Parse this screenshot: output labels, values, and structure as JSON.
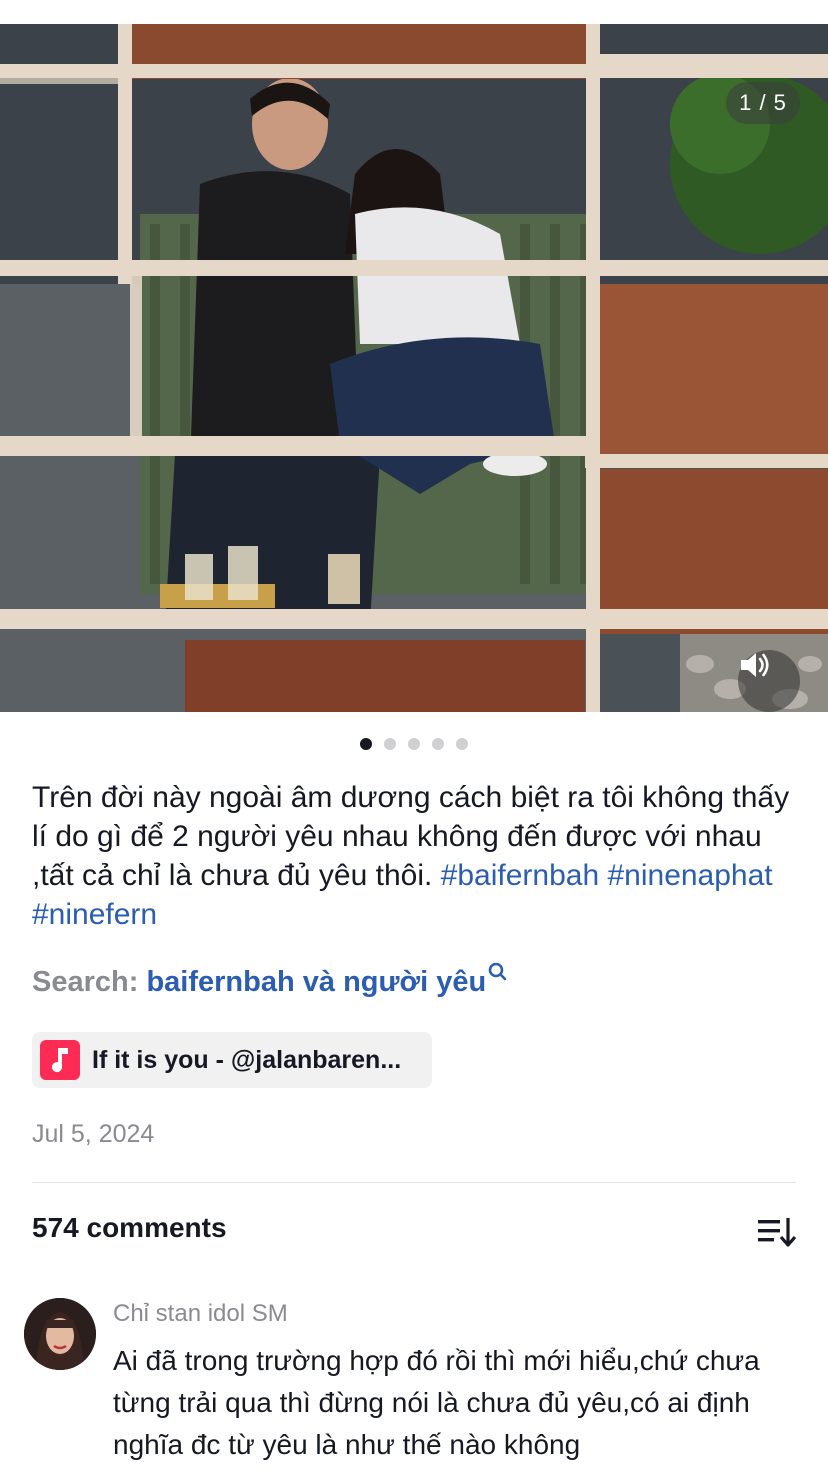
{
  "post": {
    "image_counter": "1 / 5",
    "slide_count": 5,
    "active_slide": 1,
    "caption_text": "Trên đời này ngoài âm dương cách biệt ra tôi không thấy lí do gì để 2 người yêu nhau không đến được với nhau ,tất cả chỉ là chưa đủ yêu thôi.",
    "hashtags": [
      "#baifernbah",
      "#ninenaphat",
      "#ninefern"
    ],
    "search_label": "Search:",
    "search_term": "baifernbah và người yêu",
    "music_label": "If it is you - @jalanbaren...",
    "date": "Jul 5, 2024"
  },
  "comments_section": {
    "count_label": "574 comments",
    "comments": [
      {
        "user": "Chỉ stan idol SM",
        "text": "Ai đã trong trường hợp đó rồi thì mới hiểu,chứ chưa từng trải qua thì đừng nói là chưa đủ yêu,có ai định nghĩa đc từ yêu là như thế nào không"
      }
    ]
  },
  "colors": {
    "accent_link": "#2b5db0",
    "music_brand": "#fe2c55",
    "muted_text": "#8a8b91"
  },
  "icons": {
    "sound": "speaker-icon",
    "search": "search-icon",
    "music": "music-note-icon",
    "sort": "sort-icon"
  }
}
